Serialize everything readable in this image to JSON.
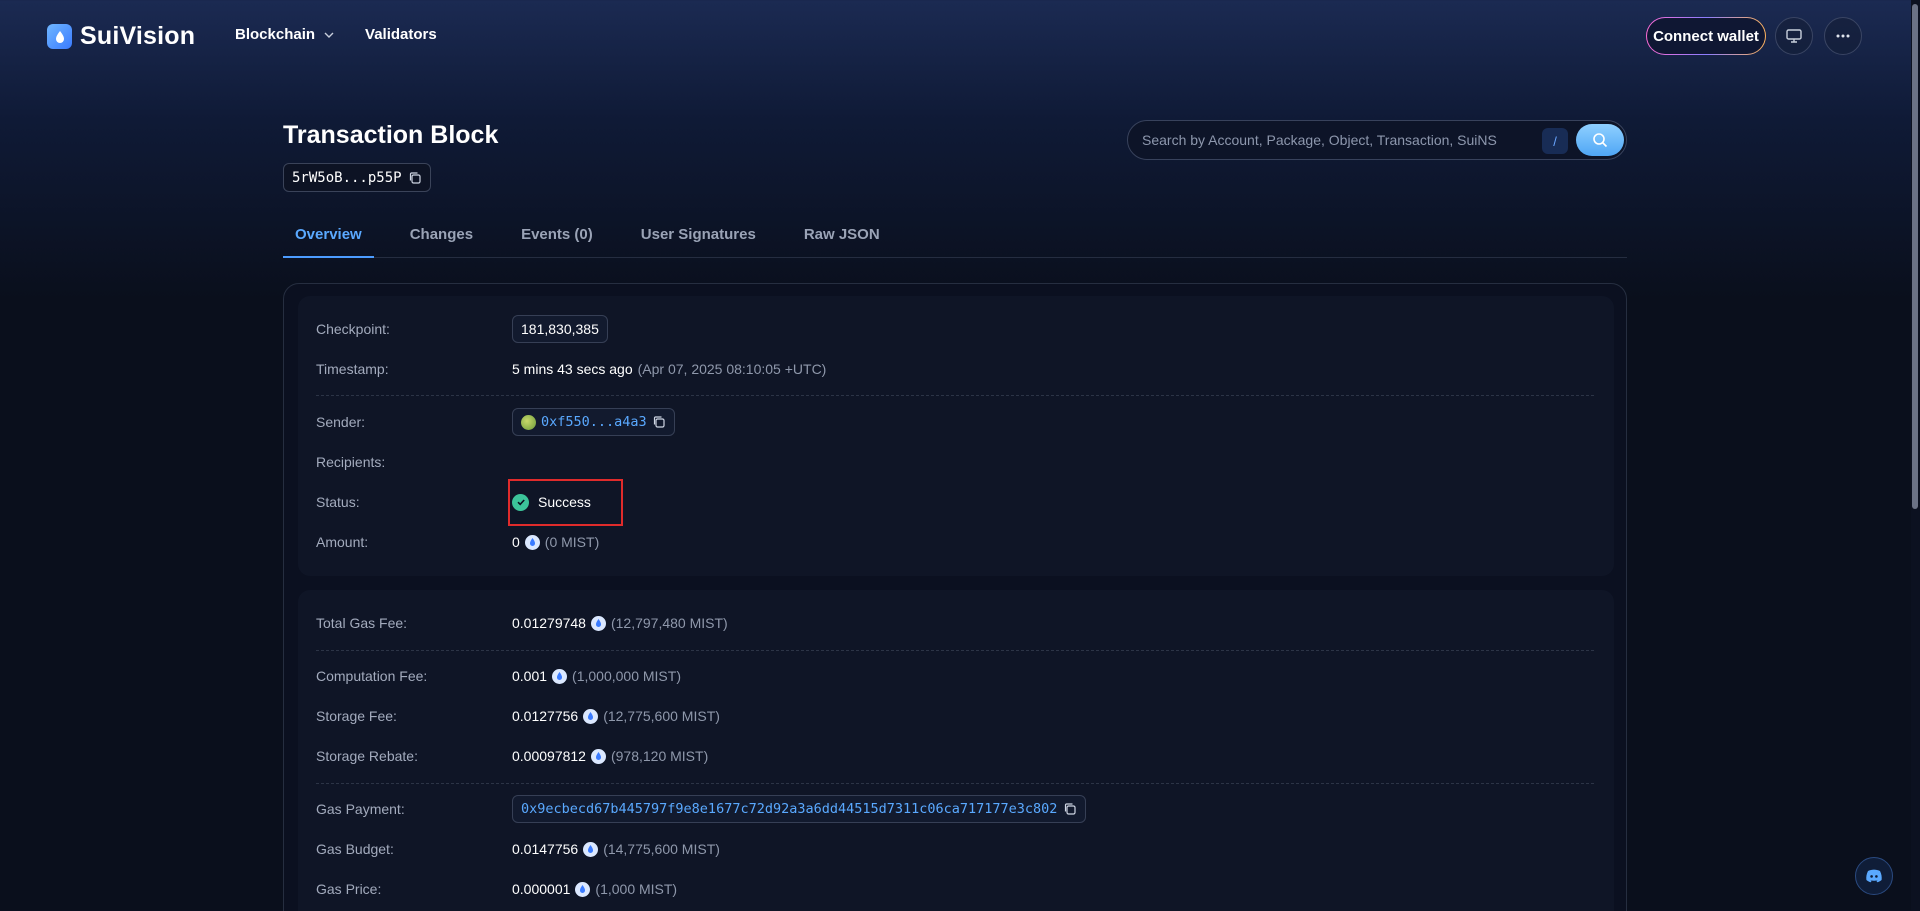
{
  "header": {
    "brand": "SuiVision",
    "nav": [
      {
        "label": "Blockchain",
        "has_dropdown": true
      },
      {
        "label": "Validators",
        "has_dropdown": false
      }
    ],
    "connect_wallet": "Connect wallet"
  },
  "page": {
    "title": "Transaction Block",
    "digest_short": "5rW5oB...p55P"
  },
  "search": {
    "placeholder": "Search by Account, Package, Object, Transaction, SuiNS",
    "shortcut": "/"
  },
  "tabs": [
    {
      "label": "Overview",
      "active": true
    },
    {
      "label": "Changes",
      "active": false
    },
    {
      "label": "Events (0)",
      "active": false
    },
    {
      "label": "User Signatures",
      "active": false
    },
    {
      "label": "Raw JSON",
      "active": false
    }
  ],
  "overview": {
    "checkpoint": {
      "label": "Checkpoint:",
      "value": "181,830,385"
    },
    "timestamp": {
      "label": "Timestamp:",
      "relative": "5 mins 43 secs ago",
      "absolute": "(Apr 07, 2025 08:10:05 +UTC)"
    },
    "sender": {
      "label": "Sender:",
      "value": "0xf550...a4a3"
    },
    "recipients": {
      "label": "Recipients:"
    },
    "status": {
      "label": "Status:",
      "value": "Success"
    },
    "amount": {
      "label": "Amount:",
      "value": "0",
      "mist": "(0 MIST)"
    }
  },
  "gas": {
    "total": {
      "label": "Total Gas Fee:",
      "value": "0.01279748",
      "mist": "(12,797,480 MIST)"
    },
    "computation": {
      "label": "Computation Fee:",
      "value": "0.001",
      "mist": "(1,000,000 MIST)"
    },
    "storage": {
      "label": "Storage Fee:",
      "value": "0.0127756",
      "mist": "(12,775,600 MIST)"
    },
    "rebate": {
      "label": "Storage Rebate:",
      "value": "0.00097812",
      "mist": "(978,120 MIST)"
    },
    "payment": {
      "label": "Gas Payment:",
      "value": "0x9ecbecd67b445797f9e8e1677c72d92a3a6dd44515d7311c06ca717177e3c802"
    },
    "budget": {
      "label": "Gas Budget:",
      "value": "0.0147756",
      "mist": "(14,775,600 MIST)"
    },
    "price": {
      "label": "Gas Price:",
      "value": "0.000001",
      "mist": "(1,000 MIST)"
    }
  },
  "colors": {
    "accent": "#5aa9ff",
    "success": "#3cc49a",
    "highlight_box": "#e02b2b"
  }
}
